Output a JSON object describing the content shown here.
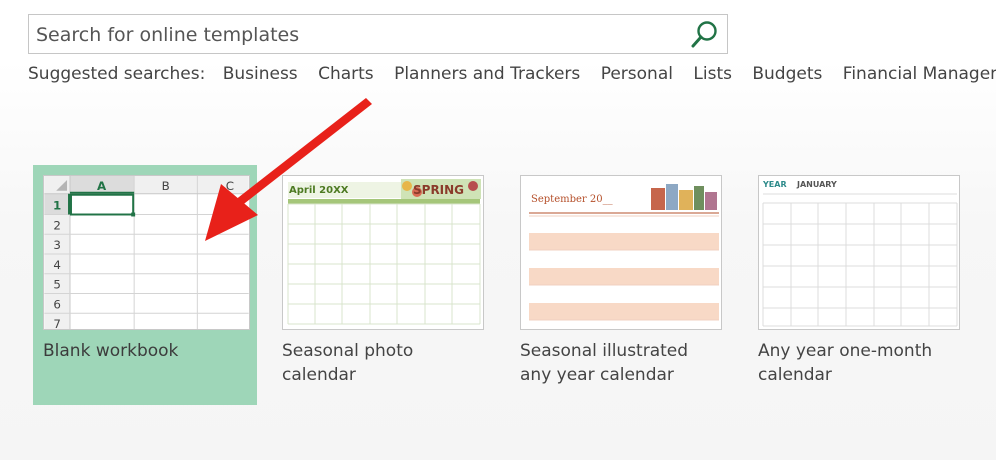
{
  "search": {
    "placeholder": "Search for online templates",
    "value": ""
  },
  "suggested": {
    "label": "Suggested searches:",
    "items": [
      "Business",
      "Charts",
      "Planners and Trackers",
      "Personal",
      "Lists",
      "Budgets",
      "Financial Management"
    ]
  },
  "templates": [
    {
      "title": "Blank workbook",
      "selected": true
    },
    {
      "title_line1": "Seasonal photo",
      "title_line2": "calendar"
    },
    {
      "title_line1": "Seasonal illustrated",
      "title_line2": "any year calendar"
    },
    {
      "title_line1": "Any year one-month",
      "title_line2": "calendar"
    }
  ],
  "blank_workbook": {
    "columns": [
      "A",
      "B",
      "C"
    ],
    "rows": [
      "1",
      "2",
      "3",
      "4",
      "5",
      "6",
      "7"
    ]
  },
  "seasonal_photo": {
    "heading": "April 20XX",
    "banner": "SPRING"
  },
  "seasonal_illustrated": {
    "heading": "September 20__"
  },
  "any_year": {
    "year": "YEAR",
    "month": "JANUARY"
  },
  "colors": {
    "accent_green": "#217346",
    "selected_tile": "#9ed6b8",
    "arrow_red": "#e8211a",
    "peach_row": "#f8d9c6",
    "photo_green": "#5a8a2b"
  },
  "icons": {
    "search": "search-icon"
  }
}
